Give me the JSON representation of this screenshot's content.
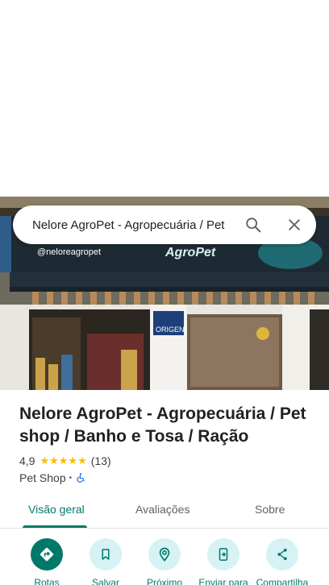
{
  "search": {
    "query": "Nelore AgroPet - Agropecuária / Pet"
  },
  "photo": {
    "sign_brand": "AgroPet",
    "sign_handle": "@neloreagropet",
    "sign_origens": "ORIGENS"
  },
  "place": {
    "title": "Nelore AgroPet - Agropecuária / Pet shop / Banho e Tosa / Ração",
    "rating": "4,9",
    "stars": "★★★★★",
    "review_count": "(13)",
    "category": "Pet Shop",
    "separator": "•"
  },
  "tabs": [
    {
      "label": "Visão geral"
    },
    {
      "label": "Avaliações"
    },
    {
      "label": "Sobre"
    }
  ],
  "actions": [
    {
      "label": "Rotas",
      "icon": "directions-icon"
    },
    {
      "label": "Salvar",
      "icon": "bookmark-icon"
    },
    {
      "label": "Próximo",
      "icon": "nearby-icon"
    },
    {
      "label": "Enviar para",
      "icon": "send-to-phone-icon"
    },
    {
      "label": "Compartilha",
      "icon": "share-icon"
    }
  ],
  "colors": {
    "accent": "#00796b",
    "chip": "#d6f2f4",
    "star": "#fbbc04"
  }
}
